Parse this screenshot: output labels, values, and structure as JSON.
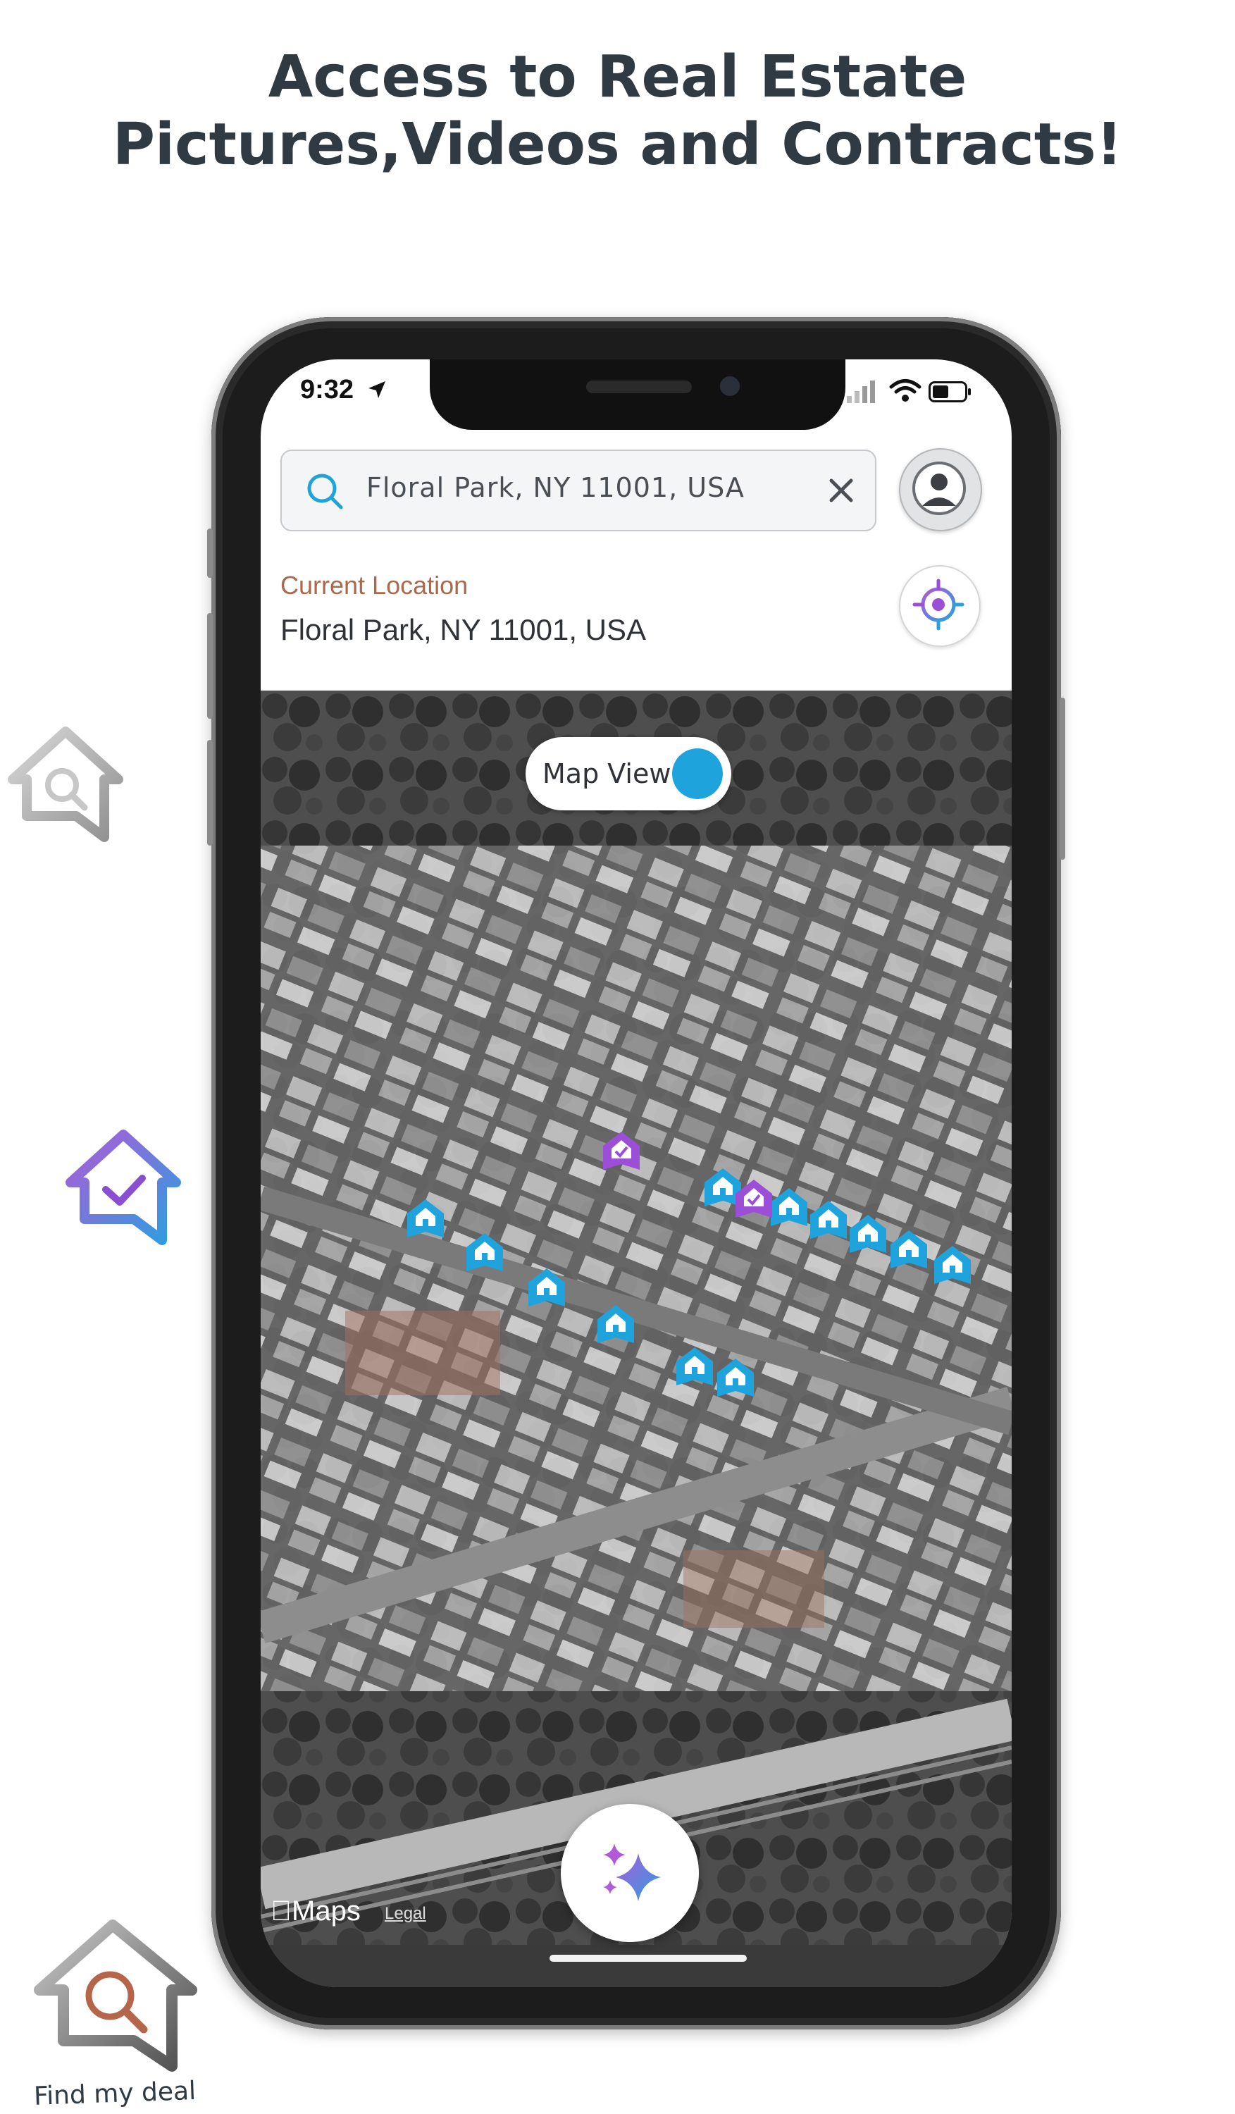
{
  "headline": {
    "line1": "Access to Real Estate",
    "line2": "Pictures,Videos and Contracts!"
  },
  "decor": {
    "caption": "Find my deal"
  },
  "status_bar": {
    "time": "9:32"
  },
  "search": {
    "value": "Floral Park, NY 11001, USA"
  },
  "location": {
    "label": "Current Location",
    "value": "Floral Park, NY 11001, USA"
  },
  "map": {
    "toggle_label": "Map View",
    "toggle_on": true,
    "brand": "Maps",
    "legal": "Legal"
  },
  "colors": {
    "accent_blue": "#1ea3dd",
    "accent_purple": "#9b4fd6",
    "label_brown": "#a9694c"
  },
  "icons": [
    "search-icon",
    "close-icon",
    "avatar-icon",
    "locate-icon",
    "sparkle-icon",
    "house-pin-icon",
    "location-arrow-icon",
    "wifi-icon",
    "battery-icon",
    "signal-icon"
  ]
}
